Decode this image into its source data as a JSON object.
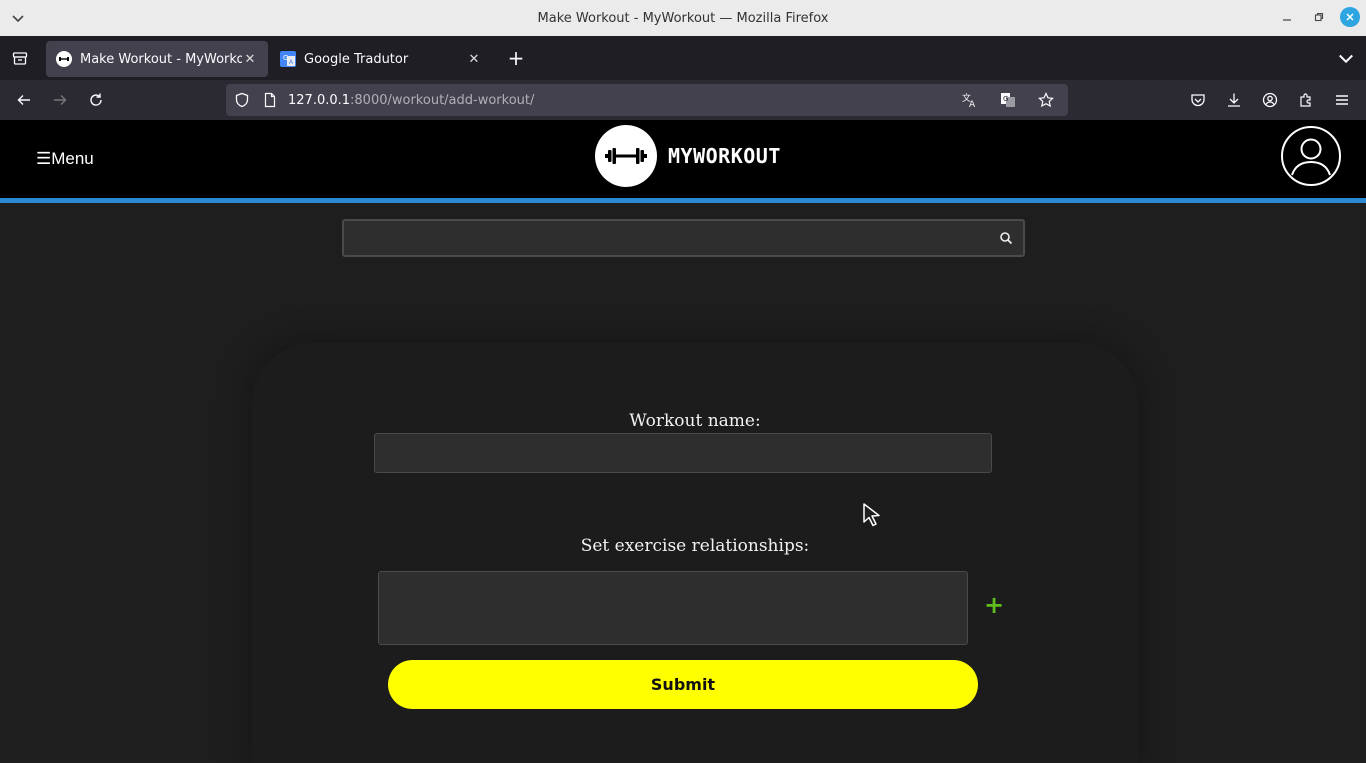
{
  "window": {
    "title": "Make Workout - MyWorkout — Mozilla Firefox"
  },
  "tabs": [
    {
      "label": "Make Workout - MyWorkout",
      "active": true,
      "favicon": "myworkout-icon"
    },
    {
      "label": "Google Tradutor",
      "active": false,
      "favicon": "google-translate-icon"
    }
  ],
  "url": {
    "host": "127.0.0.1",
    "rest": ":8000/workout/add-workout/"
  },
  "site": {
    "menu_label": "☰Menu",
    "logo_text": "MYWORKOUT",
    "accent": "#2a8ad4"
  },
  "search": {
    "placeholder": ""
  },
  "form": {
    "name_label": "Workout name:",
    "name_value": "",
    "relationships_label": "Set exercise relationships:",
    "add_label": "+",
    "submit_label": "Submit",
    "submit_color": "#ffff00",
    "add_color": "#5fbf1e"
  }
}
